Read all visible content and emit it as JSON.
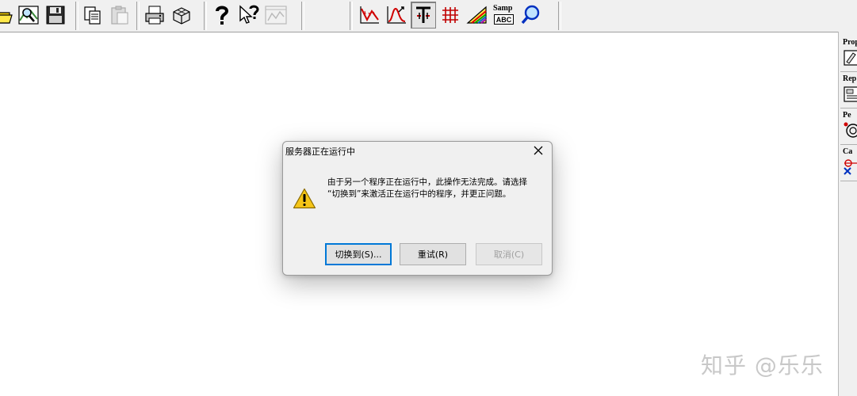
{
  "dialog": {
    "title": "服务器正在运行中",
    "message_line1": "由于另一个程序正在运行中，此操作无法完成。请选择",
    "message_line2": "“切换到”来激活正在运行中的程序，并更正问题。",
    "buttons": {
      "switch_to": "切换到(S)...",
      "retry": "重试(R)",
      "cancel": "取消(C)"
    }
  },
  "right_panel": {
    "items": [
      {
        "label": "Prop"
      },
      {
        "label": "Rep"
      },
      {
        "label": "Pe"
      },
      {
        "label": "Ca"
      }
    ]
  },
  "toolbar": {
    "sample_button": {
      "line1": "Samp",
      "line2": "ABC"
    }
  },
  "watermark": "知乎 @乐乐",
  "colors": {
    "toolbar_bg": "#f0f0f0",
    "dialog_bg": "#f0f0f0",
    "default_button_border": "#0078d7",
    "warning_yellow": "#f5c518"
  }
}
